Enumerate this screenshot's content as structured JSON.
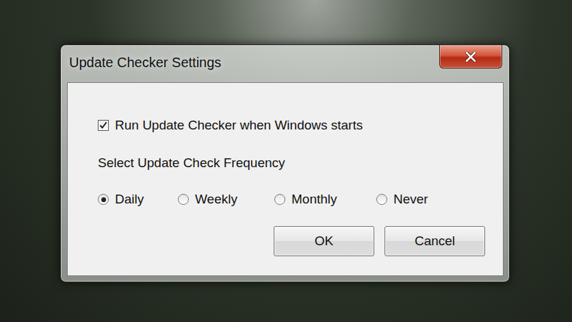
{
  "window": {
    "title": "Update Checker Settings"
  },
  "startup_checkbox": {
    "label": "Run Update Checker when Windows starts",
    "checked": true
  },
  "frequency": {
    "label": "Select Update Check Frequency",
    "options": [
      {
        "label": "Daily",
        "selected": true
      },
      {
        "label": "Weekly",
        "selected": false
      },
      {
        "label": "Monthly",
        "selected": false
      },
      {
        "label": "Never",
        "selected": false
      }
    ]
  },
  "buttons": [
    "OK",
    "Cancel"
  ]
}
